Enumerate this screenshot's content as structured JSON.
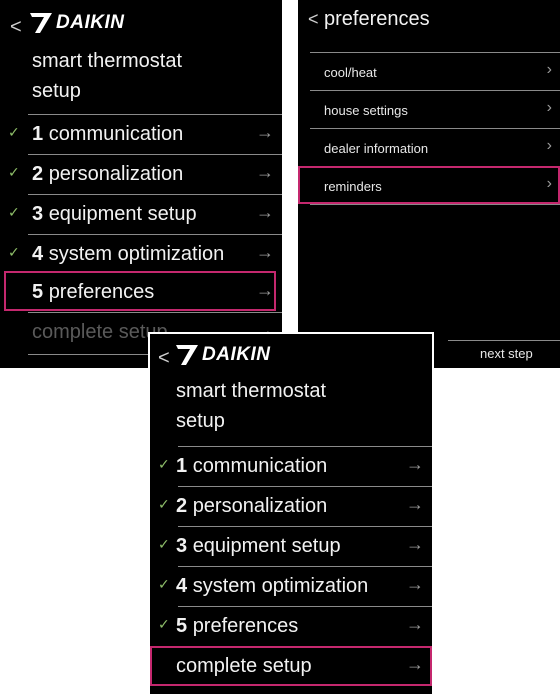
{
  "brand": "DAIKIN",
  "back_glyph": "<",
  "screen_a": {
    "title_line1": "smart thermostat",
    "title_line2": "setup",
    "items": [
      {
        "num": "1",
        "label": "communication"
      },
      {
        "num": "2",
        "label": "personalization"
      },
      {
        "num": "3",
        "label": "equipment setup"
      },
      {
        "num": "4",
        "label": "system optimization"
      },
      {
        "num": "5",
        "label": "preferences"
      }
    ],
    "complete_label": "complete setup"
  },
  "screen_b": {
    "title": "preferences",
    "items": [
      "cool/heat",
      "house settings",
      "dealer information",
      "reminders"
    ],
    "next_label": "next step"
  },
  "screen_c": {
    "title_line1": "smart thermostat",
    "title_line2": "setup",
    "items": [
      {
        "num": "1",
        "label": "communication"
      },
      {
        "num": "2",
        "label": "personalization"
      },
      {
        "num": "3",
        "label": "equipment setup"
      },
      {
        "num": "4",
        "label": "system optimization"
      },
      {
        "num": "5",
        "label": "preferences"
      }
    ],
    "complete_label": "complete setup"
  },
  "glyphs": {
    "check": "✓",
    "arrow": "→",
    "chevron": "›"
  },
  "colors": {
    "highlight": "#c4286e",
    "check": "#8fbf6a",
    "background": "#000000"
  }
}
